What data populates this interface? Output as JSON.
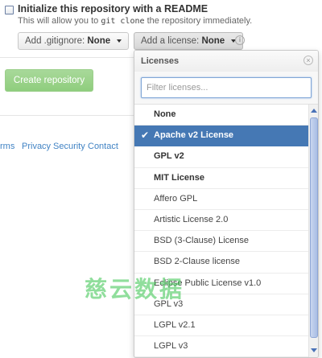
{
  "init": {
    "title": "Initialize this repository with a README",
    "desc_before": "This will allow you to ",
    "desc_code": "git clone",
    "desc_after": " the repository immediately."
  },
  "gitignore": {
    "label": "Add .gitignore:",
    "value": "None"
  },
  "license": {
    "label": "Add a license:",
    "value": "None"
  },
  "info_icon": "info-icon",
  "create_button": "Create repository",
  "footer_links": [
    "rms",
    "Privacy",
    "Security",
    "Contact"
  ],
  "dropdown": {
    "title": "Licenses",
    "close_icon": "close-icon",
    "filter_placeholder": "Filter licenses...",
    "selected_index": 1,
    "items": [
      "None",
      "Apache v2 License",
      "GPL v2",
      "MIT License",
      "Affero GPL",
      "Artistic License 2.0",
      "BSD (3-Clause) License",
      "BSD 2-Clause license",
      "Eclipse Public License v1.0",
      "GPL v3",
      "LGPL v2.1",
      "LGPL v3"
    ]
  },
  "watermark": "慈云数据",
  "colors": {
    "selected": "#4578b4",
    "link": "#4183c4",
    "create": "#8fcd7d"
  }
}
